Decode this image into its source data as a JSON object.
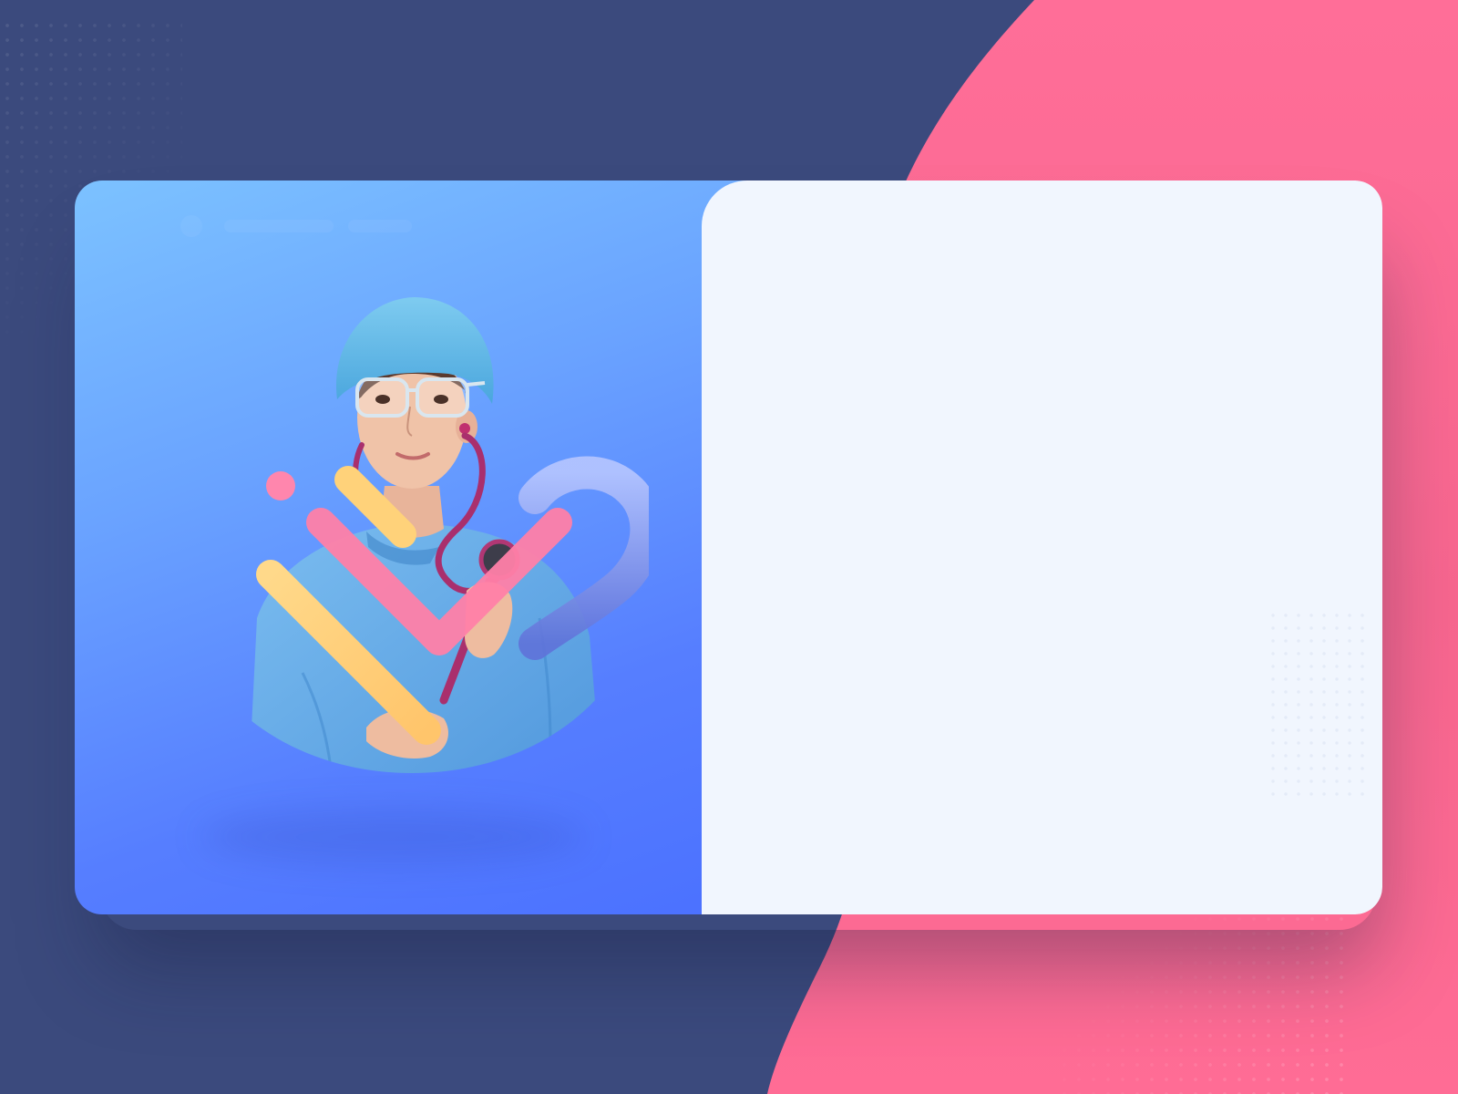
{
  "colors": {
    "background_navy": "#3b4a7d",
    "background_pink": "#ff6b97",
    "panel_gradient_start": "#7cc2ff",
    "panel_gradient_end": "#4a70ff",
    "content_panel": "#f1f6fe",
    "accent_yellow": "#ffd27a",
    "accent_pink": "#ff7aa6",
    "accent_lilac": "#a8b6ff",
    "scrub_blue": "#5fa8e6"
  },
  "illustration": {
    "subject": "medical-professional-portrait",
    "decor": [
      "pink-dot",
      "yellow-stroke",
      "pink-chevron",
      "lilac-arc"
    ]
  }
}
